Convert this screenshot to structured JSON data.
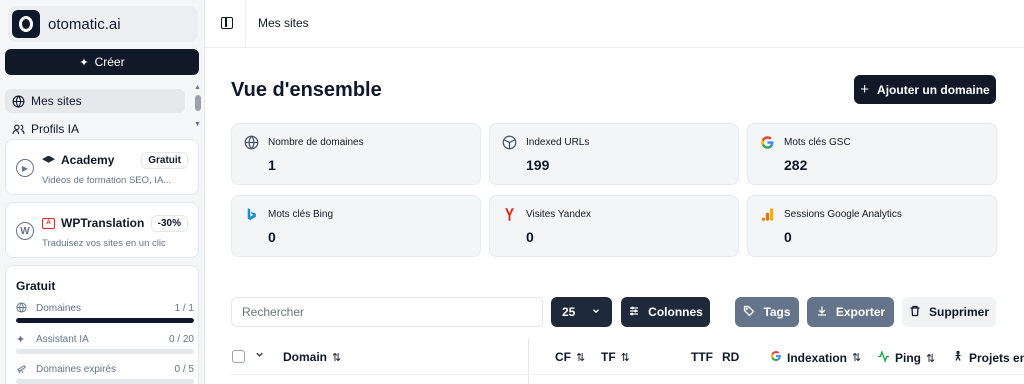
{
  "sidebar": {
    "brand": "otomatic.ai",
    "create_label": "Créer",
    "nav": [
      {
        "label": "Mes sites",
        "icon": "globe-icon"
      },
      {
        "label": "Profils IA",
        "icon": "users-icon"
      }
    ],
    "promos": [
      {
        "title": "Academy",
        "badge": "Gratuit",
        "desc": "Vidéos de formation SEO, IA...",
        "icon": "play-circle-icon"
      },
      {
        "title": "WPTranslation",
        "badge": "-30%",
        "desc": "Traduisez vos sites en un clic",
        "icon": "wordpress-icon"
      }
    ],
    "plan": {
      "title": "Gratuit",
      "items": [
        {
          "label": "Domaines",
          "count": "1 / 1",
          "progress": 1.0,
          "icon": "globe-icon"
        },
        {
          "label": "Assistant IA",
          "count": "0 / 20",
          "progress": 0.0,
          "icon": "sparkles-icon"
        },
        {
          "label": "Domaines expirés",
          "count": "0 / 5",
          "progress": 0.0,
          "icon": "telescope-icon"
        }
      ]
    }
  },
  "header": {
    "breadcrumb": "Mes sites"
  },
  "main": {
    "title": "Vue d'ensemble",
    "add_domain_label": "Ajouter un domaine",
    "stats": [
      {
        "label": "Nombre de domaines",
        "value": "1",
        "icon": "globe-icon"
      },
      {
        "label": "Indexed URLs",
        "value": "199",
        "icon": "compass-icon"
      },
      {
        "label": "Mots clés GSC",
        "value": "282",
        "icon": "google-icon"
      },
      {
        "label": "Mots clés Bing",
        "value": "0",
        "icon": "bing-icon"
      },
      {
        "label": "Visites Yandex",
        "value": "0",
        "icon": "yandex-icon"
      },
      {
        "label": "Sessions Google Analytics",
        "value": "0",
        "icon": "analytics-icon"
      }
    ],
    "toolbar": {
      "search_placeholder": "Rechercher",
      "page_size": "25",
      "columns_label": "Colonnes",
      "tags_label": "Tags",
      "export_label": "Exporter",
      "delete_label": "Supprimer"
    },
    "table": {
      "columns": [
        "Domain",
        "CF",
        "TF",
        "TTF",
        "RD",
        "Indexation",
        "Ping",
        "Projets en"
      ]
    }
  },
  "colors": {
    "primary": "#111827",
    "accent_gray": "#64748b",
    "card_bg": "#f4f5f7"
  }
}
